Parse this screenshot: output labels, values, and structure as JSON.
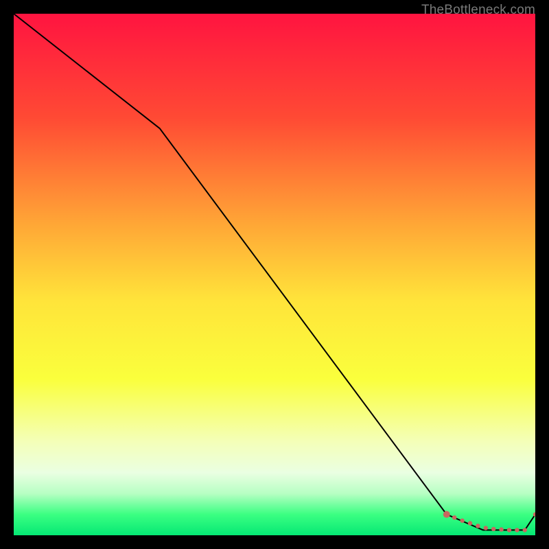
{
  "watermark": "TheBottleneck.com",
  "chart_data": {
    "type": "line",
    "title": "",
    "xlabel": "",
    "ylabel": "",
    "xlim": [
      0,
      100
    ],
    "ylim": [
      0,
      100
    ],
    "gradient_stops": [
      {
        "offset": 0,
        "color": "#ff1440"
      },
      {
        "offset": 20,
        "color": "#ff4a34"
      },
      {
        "offset": 40,
        "color": "#ffa536"
      },
      {
        "offset": 55,
        "color": "#ffe43a"
      },
      {
        "offset": 70,
        "color": "#faff3c"
      },
      {
        "offset": 82,
        "color": "#f4ffb8"
      },
      {
        "offset": 88,
        "color": "#eaffe2"
      },
      {
        "offset": 92,
        "color": "#b7ffc3"
      },
      {
        "offset": 96,
        "color": "#3bff82"
      },
      {
        "offset": 100,
        "color": "#05e874"
      }
    ],
    "series": [
      {
        "name": "curve",
        "x": [
          0,
          28,
          83,
          90,
          98,
          100
        ],
        "y": [
          100,
          78,
          4,
          1,
          1,
          4
        ]
      }
    ],
    "markers": {
      "name": "highlight-points",
      "color": "#c9675f",
      "x": [
        83,
        84.5,
        86,
        87.5,
        89,
        90.5,
        92,
        93.5,
        95,
        96.5,
        98,
        100
      ],
      "y": [
        4,
        3.4,
        2.8,
        2.3,
        1.8,
        1.4,
        1.2,
        1.1,
        1.0,
        1.0,
        1.0,
        4
      ]
    }
  }
}
